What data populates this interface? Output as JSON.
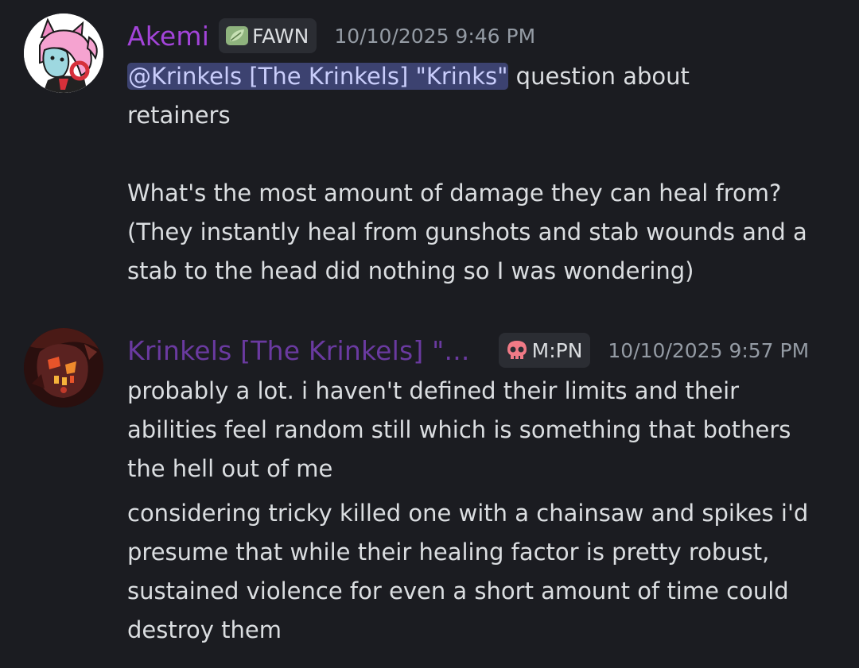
{
  "messages": [
    {
      "author": "Akemi",
      "author_color": "#a344d9",
      "tag": {
        "icon": "leaf-icon",
        "label": "FAWN"
      },
      "timestamp": "10/10/2025 9:46 PM",
      "mention": "@Krinkels [The Krinkels] \"Krinks\"",
      "first_line_rest": " question about",
      "second_line": "retainers",
      "paragraph_1": "What's the most amount of damage they can heal from?",
      "paragraph_2": "(They instantly heal from gunshots and stab wounds and a",
      "paragraph_3": "stab to the head did nothing so I was wondering)"
    },
    {
      "author": "Krinkels [The Krinkels] \"...",
      "author_color": "#6a3aa0",
      "tag": {
        "icon": "skull-icon",
        "label": "M:PN"
      },
      "timestamp": "10/10/2025 9:57 PM",
      "line_1": "probably a lot. i haven't defined their limits and their",
      "line_2": "abilities feel random still which is something that bothers",
      "line_3": "the hell out of me",
      "line_4": "considering tricky killed one with a chainsaw and spikes i'd",
      "line_5": "presume that while their healing factor is pretty robust,",
      "line_6": "sustained violence for even a short amount of time could",
      "line_7": "destroy them"
    }
  ],
  "colors": {
    "background": "#1b1c21",
    "text": "#dbdee1",
    "muted": "#949ba4",
    "mention_bg": "#3c4270",
    "mention_text": "#c9cdfb",
    "tag_bg": "#2b2d33"
  }
}
